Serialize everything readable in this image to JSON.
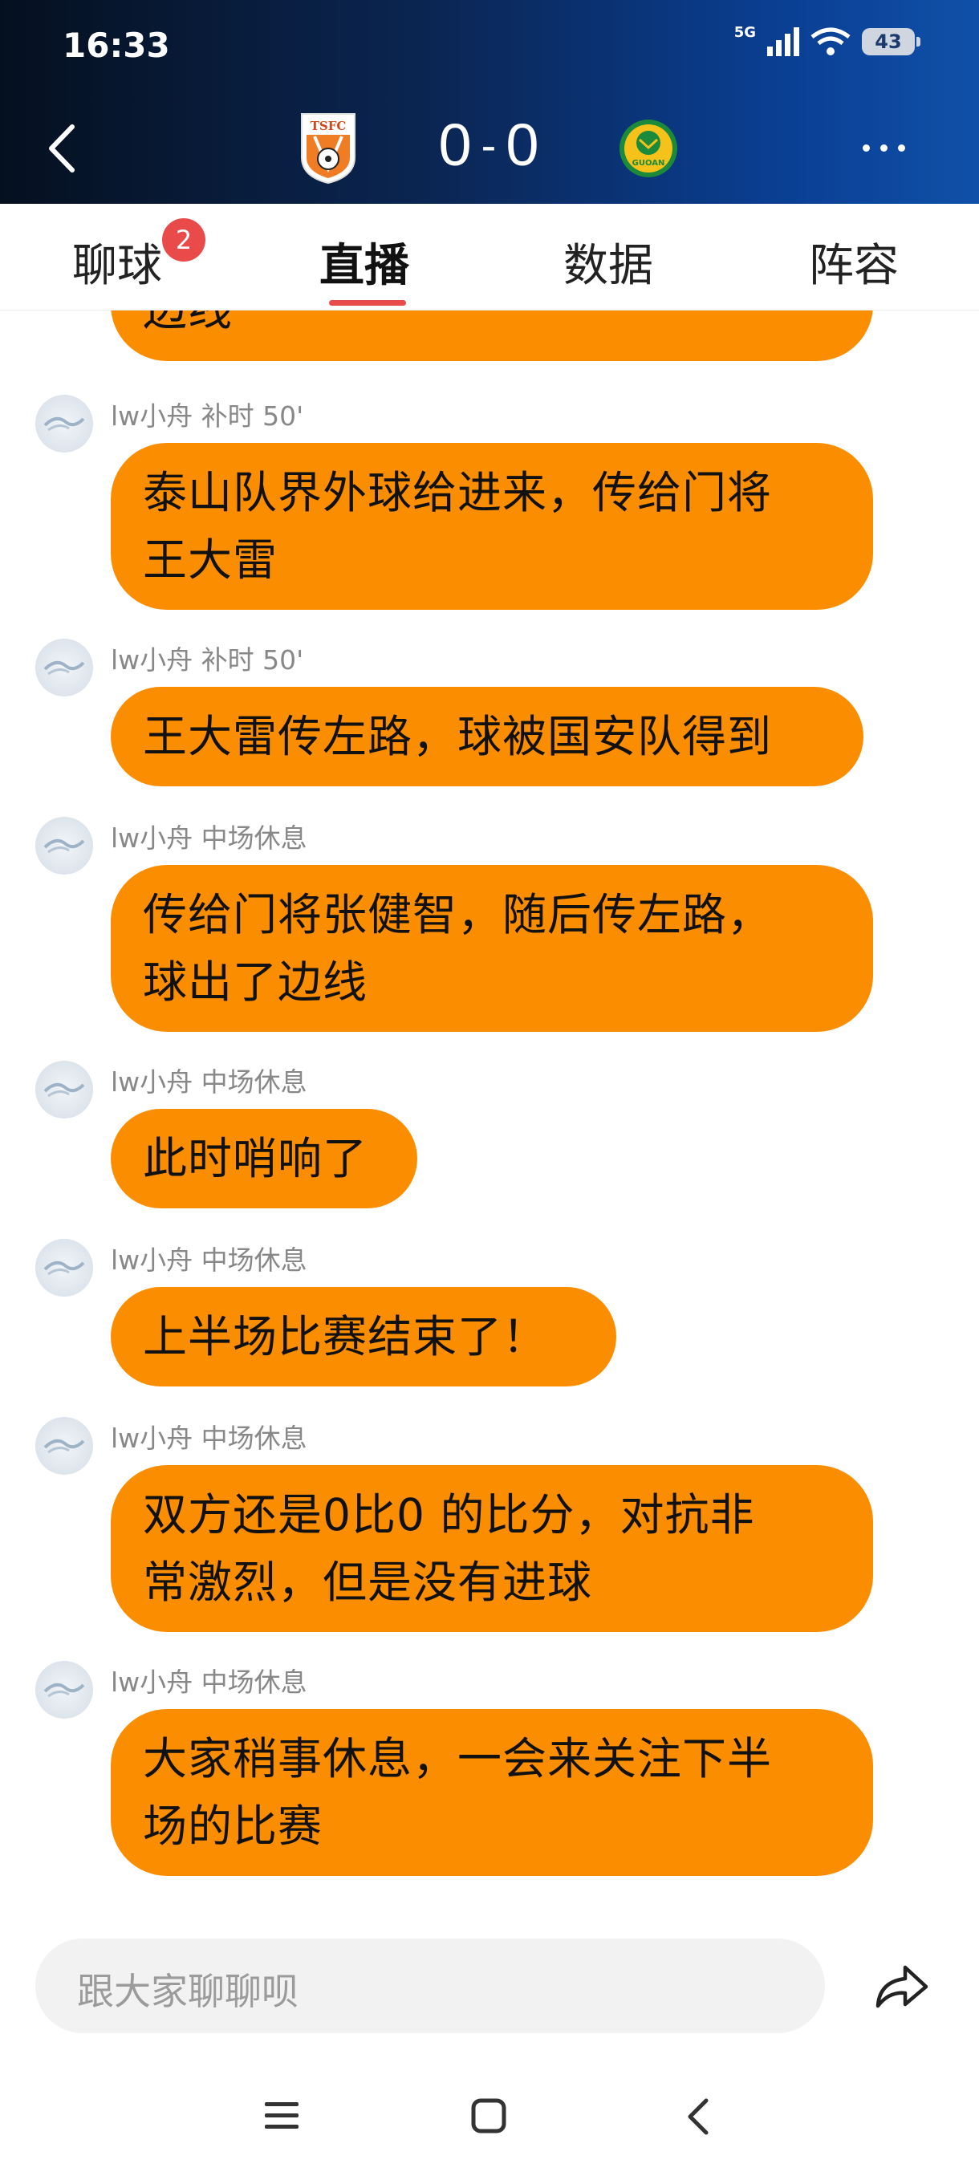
{
  "status_bar": {
    "time": "16:33",
    "network": "5G",
    "battery": "43"
  },
  "match": {
    "home_logo_text": "TSFC",
    "away_logo_text": "GUOAN",
    "score_home": "0",
    "score_separator": "-",
    "score_away": "0"
  },
  "tabs": [
    {
      "label": "聊球",
      "badge": "2"
    },
    {
      "label": "直播"
    },
    {
      "label": "数据"
    },
    {
      "label": "阵容"
    }
  ],
  "feed": {
    "partial_top_text": "边线",
    "messages": [
      {
        "author": "lw小舟",
        "time": "补时 50'",
        "text_lines": [
          "泰山队界外球给进来，传给门将",
          "王大雷"
        ]
      },
      {
        "author": "lw小舟",
        "time": "补时 50'",
        "text_lines": [
          "王大雷传左路，球被国安队得到"
        ]
      },
      {
        "author": "lw小舟",
        "time": "中场休息",
        "text_lines": [
          "传给门将张健智，随后传左路，",
          "球出了边线"
        ]
      },
      {
        "author": "lw小舟",
        "time": "中场休息",
        "text_lines": [
          "此时哨响了"
        ]
      },
      {
        "author": "lw小舟",
        "time": "中场休息",
        "text_lines": [
          "上半场比赛结束了！"
        ]
      },
      {
        "author": "lw小舟",
        "time": "中场休息",
        "text_lines": [
          "双方还是0比0 的比分，对抗非",
          "常激烈，但是没有进球"
        ]
      },
      {
        "author": "lw小舟",
        "time": "中场休息",
        "text_lines": [
          "大家稍事休息，一会来关注下半",
          "场的比赛"
        ]
      }
    ]
  },
  "input": {
    "placeholder": "跟大家聊聊呗"
  },
  "icons": {
    "back": "chevron-left-icon",
    "more": "more-dots-icon",
    "share": "share-arrow-icon",
    "nav_menu": "menu-icon",
    "nav_home": "home-square-icon",
    "nav_back": "back-icon"
  },
  "colors": {
    "bubble": "#fb8d00",
    "badge": "#e94a4a",
    "tab_indicator": "#e84b4b"
  }
}
